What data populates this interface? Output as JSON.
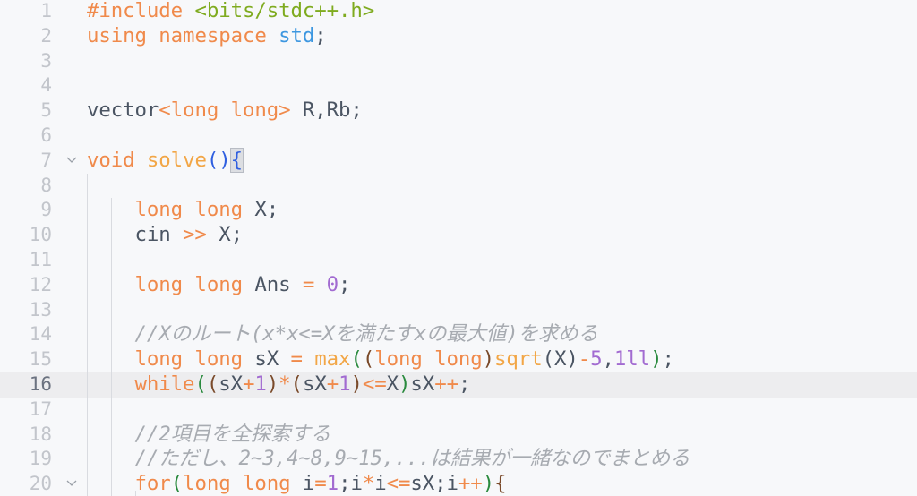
{
  "editor": {
    "current_line": 16,
    "lines": [
      {
        "n": "1",
        "fold": false,
        "tokens": [
          [
            "kw",
            "#include"
          ],
          [
            "tx",
            " "
          ],
          [
            "str",
            "<bits/stdc++.h>"
          ]
        ]
      },
      {
        "n": "2",
        "fold": false,
        "tokens": [
          [
            "kw",
            "using"
          ],
          [
            "tx",
            " "
          ],
          [
            "kw",
            "namespace"
          ],
          [
            "tx",
            " "
          ],
          [
            "ns",
            "std"
          ],
          [
            "tx",
            ";"
          ]
        ]
      },
      {
        "n": "3",
        "fold": false,
        "tokens": []
      },
      {
        "n": "4",
        "fold": false,
        "tokens": []
      },
      {
        "n": "5",
        "fold": false,
        "tokens": [
          [
            "tx",
            "vector"
          ],
          [
            "op",
            "<"
          ],
          [
            "kw",
            "long long"
          ],
          [
            "op",
            ">"
          ],
          [
            "tx",
            " R,Rb;"
          ]
        ]
      },
      {
        "n": "6",
        "fold": false,
        "tokens": []
      },
      {
        "n": "7",
        "fold": true,
        "tokens": [
          [
            "kw",
            "void"
          ],
          [
            "tx",
            " "
          ],
          [
            "fn",
            "solve"
          ],
          [
            "bb",
            "()"
          ],
          [
            "bmatch",
            "{"
          ]
        ]
      },
      {
        "n": "8",
        "fold": false,
        "tokens": []
      },
      {
        "n": "9",
        "fold": false,
        "tokens": [
          [
            "tx",
            "    "
          ],
          [
            "kw",
            "long long"
          ],
          [
            "tx",
            " X;"
          ]
        ]
      },
      {
        "n": "10",
        "fold": false,
        "tokens": [
          [
            "tx",
            "    cin "
          ],
          [
            "op",
            ">>"
          ],
          [
            "tx",
            " X;"
          ]
        ]
      },
      {
        "n": "11",
        "fold": false,
        "tokens": []
      },
      {
        "n": "12",
        "fold": false,
        "tokens": [
          [
            "tx",
            "    "
          ],
          [
            "kw",
            "long long"
          ],
          [
            "tx",
            " Ans "
          ],
          [
            "op",
            "="
          ],
          [
            "tx",
            " "
          ],
          [
            "num",
            "0"
          ],
          [
            "tx",
            ";"
          ]
        ]
      },
      {
        "n": "13",
        "fold": false,
        "tokens": []
      },
      {
        "n": "14",
        "fold": false,
        "tokens": [
          [
            "tx",
            "    "
          ],
          [
            "cm",
            "//Xのルート(x*x<=Xを満たすxの最大値)を求める"
          ]
        ]
      },
      {
        "n": "15",
        "fold": false,
        "tokens": [
          [
            "tx",
            "    "
          ],
          [
            "kw",
            "long long"
          ],
          [
            "tx",
            " sX "
          ],
          [
            "op",
            "="
          ],
          [
            "tx",
            " "
          ],
          [
            "fn",
            "max"
          ],
          [
            "b1",
            "("
          ],
          [
            "b2",
            "("
          ],
          [
            "kw",
            "long long"
          ],
          [
            "b2",
            ")"
          ],
          [
            "fn",
            "sqrt"
          ],
          [
            "tx",
            "(X)"
          ],
          [
            "op",
            "-"
          ],
          [
            "num",
            "5"
          ],
          [
            "tx",
            ","
          ],
          [
            "num",
            "1ll"
          ],
          [
            "b1",
            ")"
          ],
          [
            "tx",
            ";"
          ]
        ]
      },
      {
        "n": "16",
        "fold": false,
        "tokens": [
          [
            "tx",
            "    "
          ],
          [
            "kw",
            "while"
          ],
          [
            "b1",
            "("
          ],
          [
            "b2",
            "("
          ],
          [
            "tx",
            "sX"
          ],
          [
            "op",
            "+"
          ],
          [
            "num",
            "1"
          ],
          [
            "b2",
            ")"
          ],
          [
            "op",
            "*"
          ],
          [
            "b2",
            "("
          ],
          [
            "tx",
            "sX"
          ],
          [
            "op",
            "+"
          ],
          [
            "num",
            "1"
          ],
          [
            "b2",
            ")"
          ],
          [
            "op",
            "<="
          ],
          [
            "tx",
            "X"
          ],
          [
            "b1",
            ")"
          ],
          [
            "tx",
            "sX"
          ],
          [
            "op",
            "++"
          ],
          [
            "tx",
            ";"
          ]
        ]
      },
      {
        "n": "17",
        "fold": false,
        "tokens": []
      },
      {
        "n": "18",
        "fold": false,
        "tokens": [
          [
            "tx",
            "    "
          ],
          [
            "cm",
            "//2項目を全探索する"
          ]
        ]
      },
      {
        "n": "19",
        "fold": false,
        "tokens": [
          [
            "tx",
            "    "
          ],
          [
            "cm",
            "//ただし、2~3,4~8,9~15,...は結果が一緒なのでまとめる"
          ]
        ]
      },
      {
        "n": "20",
        "fold": true,
        "tokens": [
          [
            "tx",
            "    "
          ],
          [
            "kw",
            "for"
          ],
          [
            "b1",
            "("
          ],
          [
            "kw",
            "long long"
          ],
          [
            "tx",
            " i"
          ],
          [
            "op",
            "="
          ],
          [
            "num",
            "1"
          ],
          [
            "tx",
            ";i"
          ],
          [
            "op",
            "*"
          ],
          [
            "tx",
            "i"
          ],
          [
            "op",
            "<="
          ],
          [
            "tx",
            "sX;i"
          ],
          [
            "op",
            "++"
          ],
          [
            "b1",
            ")"
          ],
          [
            "b2",
            "{"
          ]
        ]
      }
    ],
    "fold_icon": "chevron-down-icon",
    "colors": {
      "background": "#f7f8fa",
      "current_line": "#ededef",
      "keyword": "#f08a4b",
      "function": "#f2a646",
      "string": "#7fab1f",
      "namespace": "#3d97e0",
      "number": "#a26bd1",
      "comment": "#a7abb1",
      "bracket_level1": "#2a8a3e",
      "bracket_level2": "#7a4a2a",
      "bracket_matched": "#2f5fe0"
    }
  }
}
